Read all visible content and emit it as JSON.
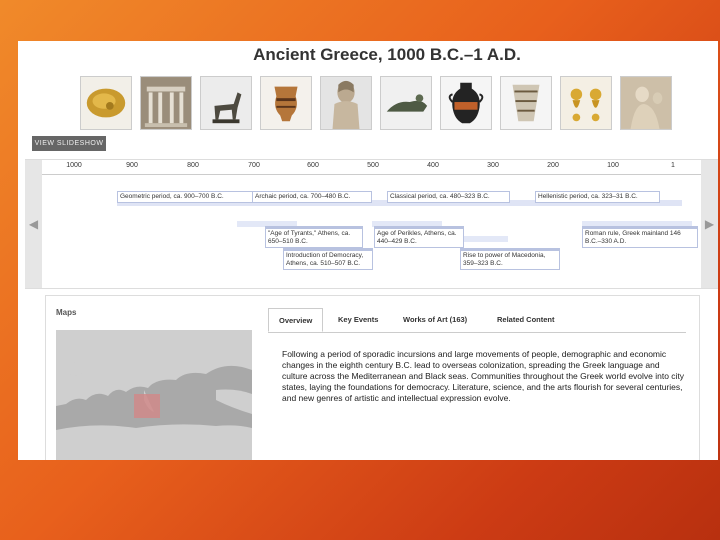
{
  "page": {
    "title": "Ancient Greece, 1000 B.C.–1 A.D."
  },
  "thumbnails": [
    {
      "name": "gold-ornament-thumbnail"
    },
    {
      "name": "temple-model-thumbnail"
    },
    {
      "name": "horse-figurine-thumbnail"
    },
    {
      "name": "krater-vase-thumbnail"
    },
    {
      "name": "kouros-statue-thumbnail"
    },
    {
      "name": "reclining-figure-thumbnail"
    },
    {
      "name": "amphora-thumbnail"
    },
    {
      "name": "kalathos-vase-thumbnail"
    },
    {
      "name": "gold-earrings-thumbnail"
    },
    {
      "name": "relief-sculpture-thumbnail"
    }
  ],
  "slideshow": {
    "label": "VIEW SLIDESHOW"
  },
  "timeline": {
    "ticks": [
      "1000",
      "900",
      "800",
      "700",
      "600",
      "500",
      "400",
      "300",
      "200",
      "100",
      "1"
    ],
    "events": [
      {
        "label": "Geometric period, ca. 900–700 B.C."
      },
      {
        "label": "Archaic period, ca. 700–480 B.C."
      },
      {
        "label": "Classical period, ca. 480–323 B.C."
      },
      {
        "label": "Hellenistic period, ca. 323–31 B.C."
      },
      {
        "label": "\"Age of Tyrants,\" Athens, ca. 650–510 B.C."
      },
      {
        "label": "Introduction of Democracy, Athens, ca. 510–507 B.C."
      },
      {
        "label": "Age of Perikles, Athens, ca. 440–429 B.C."
      },
      {
        "label": "Rise to power of Macedonia, 359–323 B.C."
      },
      {
        "label": "Roman rule, Greek mainland 146 B.C.–330 A.D."
      }
    ]
  },
  "maps": {
    "label": "Maps"
  },
  "tabs": [
    {
      "label": "Overview"
    },
    {
      "label": "Key Events"
    },
    {
      "label": "Works of Art (163)"
    },
    {
      "label": "Related Content"
    }
  ],
  "overview": {
    "text": "Following a period of sporadic incursions and large movements of people, demographic and economic changes in the eighth century B.C. lead to overseas colonization, spreading the Greek language and culture across the Mediterranean and Black seas. Communities throughout the Greek world evolve into city states, laying the foundations for democracy. Literature, science, and the arts flourish for several centuries, and new genres of artistic and intellectual expression evolve."
  },
  "colors": {
    "accent": "#e8601c",
    "timeline_band": "#dfe4f5",
    "event_border": "#b8c2e0"
  }
}
